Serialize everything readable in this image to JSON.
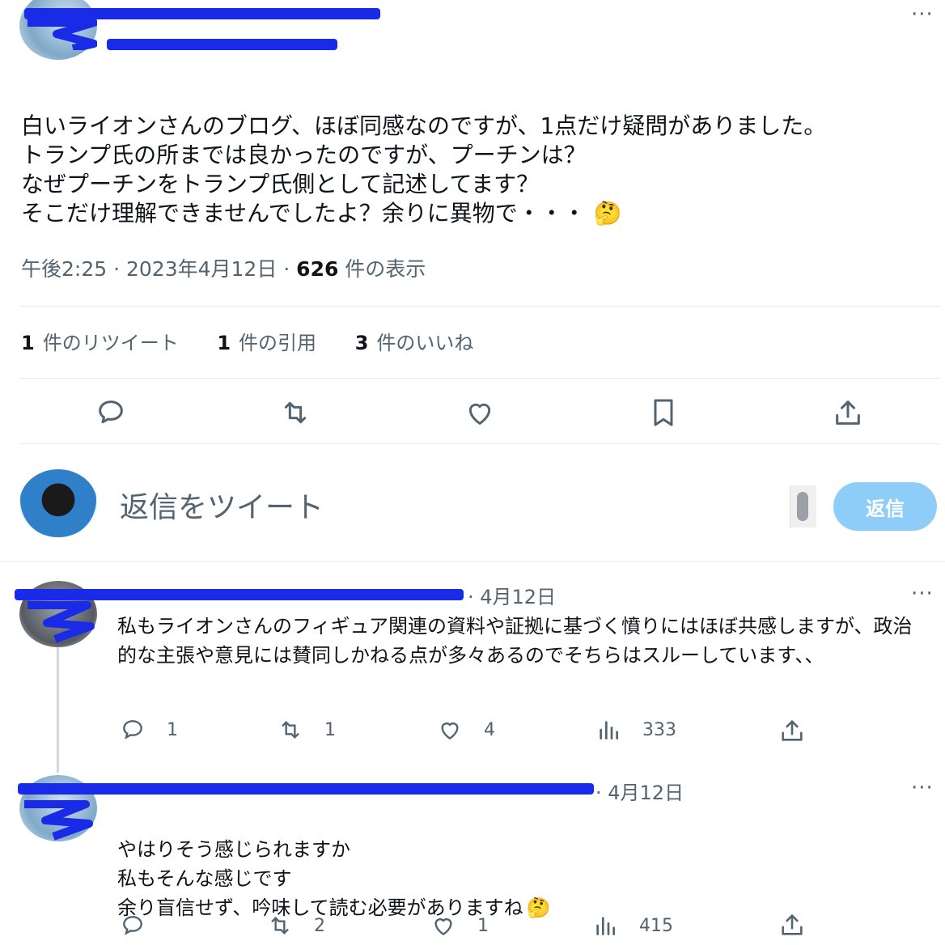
{
  "main_tweet": {
    "text": "白いライオンさんのブログ、ほぼ同感なのですが、1点だけ疑問がありました。\nトランプ氏の所までは良かったのですが、プーチンは？\nなぜプーチンをトランプ氏側として記述してます？\nそこだけ理解できませんでしたよ？余りに異物で・・・",
    "emoji": "🤔",
    "time": "午後2:25 · 2023年4月12日 · ",
    "views_num": "626",
    "views_label": " 件の表示"
  },
  "stats": {
    "retweets_num": "1",
    "retweets_label": "件のリツイート",
    "quotes_num": "1",
    "quotes_label": "件の引用",
    "likes_num": "3",
    "likes_label": "件のいいね"
  },
  "composer": {
    "placeholder": "返信をツイート",
    "reply_button": "返信"
  },
  "replies": [
    {
      "date": "· 4月12日",
      "text": "私もライオンさんのフィギュア関連の資料や証拠に基づく憤りにはほぼ共感しますが、政治的な主張や意見には賛同しかねる点が多々あるのでそちらはスルーしています、、",
      "reply_count": "1",
      "retweet_count": "1",
      "like_count": "4",
      "view_count": "333"
    },
    {
      "date": "· 4月12日",
      "text": "やはりそう感じられますか\n私もそんな感じです\n余り盲信せず、吟味して読む必要がありますね",
      "emoji": "🤔",
      "reply_count": "",
      "retweet_count": "2",
      "like_count": "1",
      "view_count": "415"
    }
  ],
  "colors": {
    "accent": "#1d9bf0",
    "reply_button_disabled": "#8ecdf8",
    "redaction": "#1a2be8"
  }
}
